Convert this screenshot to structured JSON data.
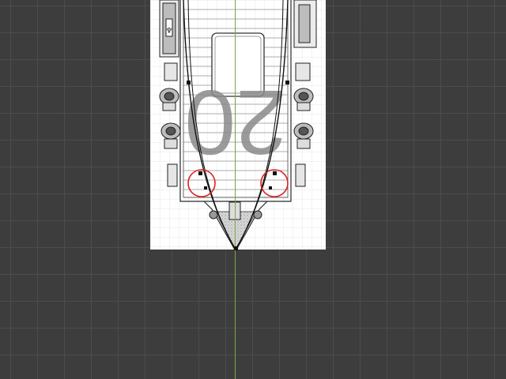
{
  "viewport": {
    "background_color": "#3d3d3d",
    "grid_color": "#4c4c4c",
    "axis_color": "#7fa54a"
  },
  "reference_image": {
    "hull_number": "20",
    "paper_color": "#ffffff",
    "line_color": "#222222",
    "digits_color": "#8a8a8a"
  },
  "curve": {
    "stroke_color": "#111111"
  },
  "markers": {
    "color": "#e02020",
    "count": 2
  }
}
